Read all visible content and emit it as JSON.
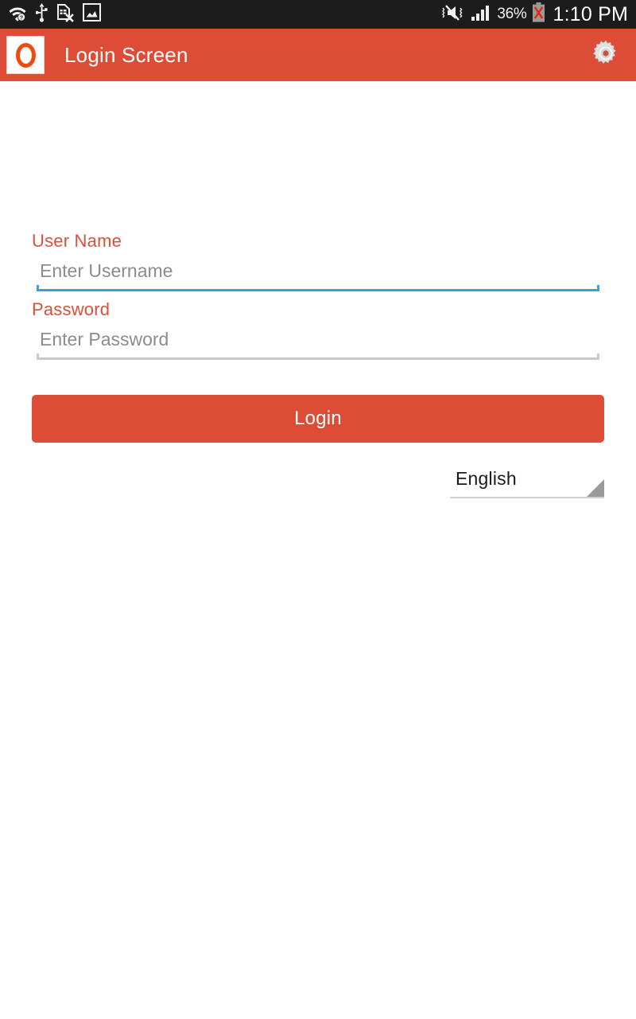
{
  "status_bar": {
    "left_icons": [
      {
        "name": "wifi-question-icon",
        "label": "Wi-Fi no internet"
      },
      {
        "name": "usb-icon",
        "label": "USB connected"
      },
      {
        "name": "sim-missing-icon",
        "label": "No SIM card"
      },
      {
        "name": "screenshot-icon",
        "label": "Screenshot saved"
      }
    ],
    "right_icons": [
      {
        "name": "mute-vibrate-icon",
        "label": "Silent with vibrate"
      },
      {
        "name": "signal-bars-icon",
        "label": "Mobile signal"
      },
      {
        "name": "battery-error-icon",
        "label": "Battery not charging"
      }
    ],
    "battery_percent": "36%",
    "clock": "1:10 PM"
  },
  "app_bar": {
    "logo_letter": "O",
    "title": "Login Screen",
    "settings_icon": "gear-icon"
  },
  "form": {
    "username": {
      "label": "User Name",
      "placeholder": "Enter Username",
      "value": "",
      "focused": true
    },
    "password": {
      "label": "Password",
      "placeholder": "Enter Password",
      "value": "",
      "focused": false
    },
    "login_button": "Login",
    "language": {
      "selected": "English",
      "options": [
        "English"
      ]
    }
  },
  "colors": {
    "accent": "#dc4c36",
    "label": "#d9503a",
    "focus_underline": "#2fa6d8",
    "idle_underline": "#c9c9c9",
    "status_bar_bg": "#1c1c1c",
    "page_bg": "#ffffff"
  }
}
